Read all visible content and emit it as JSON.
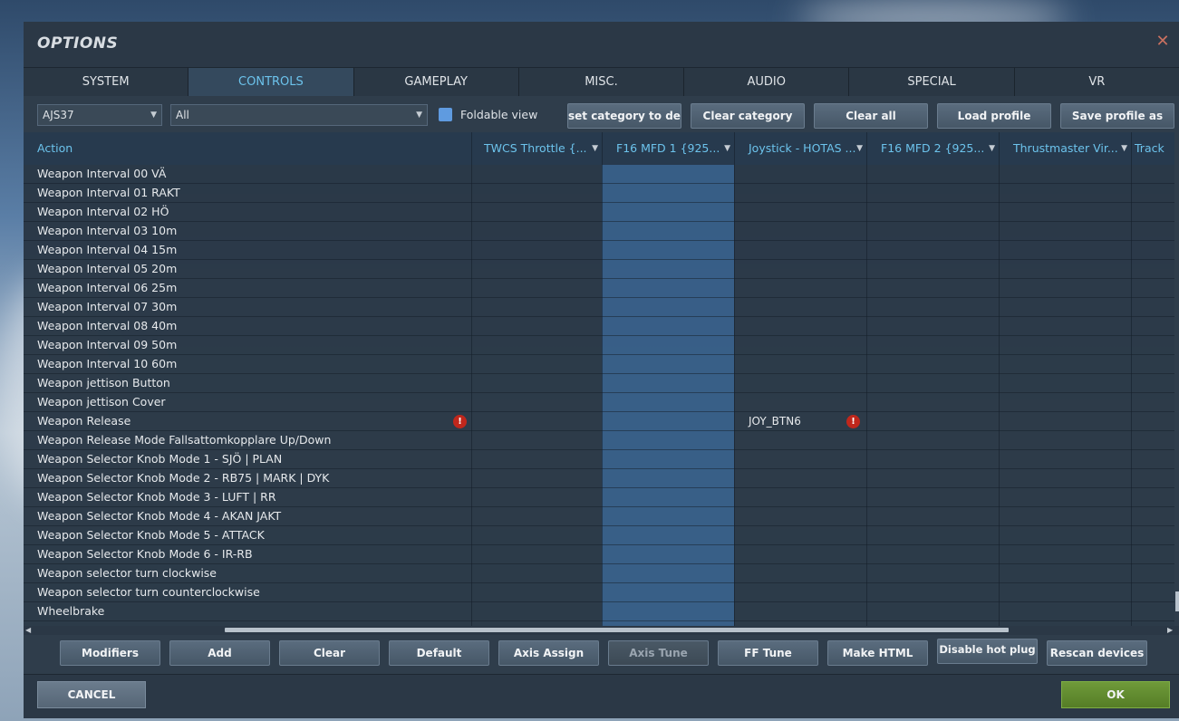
{
  "window": {
    "title": "OPTIONS",
    "close_glyph": "✕"
  },
  "tabs": [
    {
      "label": "SYSTEM"
    },
    {
      "label": "CONTROLS"
    },
    {
      "label": "GAMEPLAY"
    },
    {
      "label": "MISC."
    },
    {
      "label": "AUDIO"
    },
    {
      "label": "SPECIAL"
    },
    {
      "label": "VR"
    }
  ],
  "active_tab": "CONTROLS",
  "toolbar": {
    "aircraft_select": "AJS37",
    "category_select": "All",
    "foldable_label": "Foldable view",
    "foldable_checked": true,
    "reset_category_label": "set category to defa",
    "clear_category_label": "Clear category",
    "clear_all_label": "Clear all",
    "load_profile_label": "Load profile",
    "save_profile_label": "Save profile as"
  },
  "grid": {
    "action_header": "Action",
    "columns": [
      {
        "label": "TWCS Throttle {..."
      },
      {
        "label": "F16 MFD 1 {925..."
      },
      {
        "label": "Joystick - HOTAS ..."
      },
      {
        "label": "F16 MFD 2 {925..."
      },
      {
        "label": "Thrustmaster Vir..."
      },
      {
        "label": "Track"
      }
    ],
    "rows": [
      {
        "action": "Weapon Interval 00 VÄ"
      },
      {
        "action": "Weapon Interval 01 RAKT"
      },
      {
        "action": "Weapon Interval 02 HÖ"
      },
      {
        "action": "Weapon Interval 03 10m"
      },
      {
        "action": "Weapon Interval 04 15m"
      },
      {
        "action": "Weapon Interval 05 20m"
      },
      {
        "action": "Weapon Interval 06 25m"
      },
      {
        "action": "Weapon Interval 07 30m"
      },
      {
        "action": "Weapon Interval 08 40m"
      },
      {
        "action": "Weapon Interval 09 50m"
      },
      {
        "action": "Weapon Interval 10 60m"
      },
      {
        "action": "Weapon jettison Button"
      },
      {
        "action": "Weapon jettison Cover"
      },
      {
        "action": "Weapon Release",
        "binding": "JOY_BTN6",
        "warn": true
      },
      {
        "action": "Weapon Release Mode Fallsattomkopplare Up/Down"
      },
      {
        "action": "Weapon Selector Knob Mode 1 - SJÖ | PLAN"
      },
      {
        "action": "Weapon Selector Knob Mode 2 - RB75 | MARK | DYK"
      },
      {
        "action": "Weapon Selector Knob Mode 3 - LUFT | RR"
      },
      {
        "action": "Weapon Selector Knob Mode 4 - AKAN JAKT"
      },
      {
        "action": "Weapon Selector Knob Mode 5 - ATTACK"
      },
      {
        "action": "Weapon Selector Knob Mode 6 - IR-RB"
      },
      {
        "action": "Weapon selector turn clockwise"
      },
      {
        "action": "Weapon selector turn counterclockwise"
      },
      {
        "action": "Wheelbrake"
      }
    ],
    "warn_glyph": "!"
  },
  "bottom_buttons": {
    "modifiers": "Modifiers",
    "add": "Add",
    "clear": "Clear",
    "default": "Default",
    "axis_assign": "Axis Assign",
    "axis_tune": "Axis Tune",
    "ff_tune": "FF Tune",
    "make_html": "Make HTML",
    "disable_hot_plug": "Disable hot plug",
    "rescan_devices": "Rescan devices"
  },
  "footer": {
    "cancel_label": "CANCEL",
    "ok_label": "OK"
  },
  "colors": {
    "accent": "#6cc3ec",
    "ok": "#5f8a2d",
    "warn": "#c0271c",
    "checkbox": "#5f9be0"
  },
  "icons": {
    "dropdown": "chevron-down-icon",
    "close": "close-icon",
    "warning": "warning-icon",
    "checkbox": "checkbox-icon"
  }
}
